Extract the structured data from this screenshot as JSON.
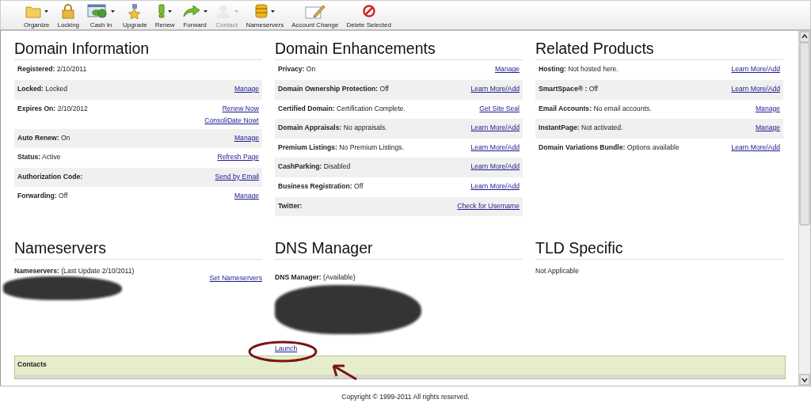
{
  "toolbar": [
    {
      "label": "Organize",
      "has_menu": true,
      "disabled": false
    },
    {
      "label": "Locking",
      "has_menu": false,
      "disabled": false
    },
    {
      "label": "Cash In",
      "has_menu": true,
      "disabled": false
    },
    {
      "label": "Upgrade",
      "has_menu": false,
      "disabled": false
    },
    {
      "label": "Renew",
      "has_menu": true,
      "disabled": false
    },
    {
      "label": "Forward",
      "has_menu": true,
      "disabled": false
    },
    {
      "label": "Contact",
      "has_menu": true,
      "disabled": true
    },
    {
      "label": "Nameservers",
      "has_menu": true,
      "disabled": false
    },
    {
      "label": "Account Change",
      "has_menu": false,
      "disabled": false
    },
    {
      "label": "Delete Selected",
      "has_menu": false,
      "disabled": false
    }
  ],
  "sections_top": [
    {
      "title": "Domain Information",
      "rows": [
        {
          "label": "Registered:",
          "value": "2/10/2011",
          "links": []
        },
        {
          "label": "Locked:",
          "value": "Locked",
          "links": [
            "Manage"
          ]
        },
        {
          "label": "Expires On:",
          "value": "2/10/2012",
          "links": [
            "Renew Now",
            "ConsoliDate Now!"
          ]
        },
        {
          "label": "Auto Renew:",
          "value": "On",
          "links": [
            "Manage"
          ]
        },
        {
          "label": "Status:",
          "value": "Active",
          "links": [
            "Refresh Page"
          ]
        },
        {
          "label": "Authorization Code:",
          "value": "",
          "links": [
            "Send by Email"
          ]
        },
        {
          "label": "Forwarding:",
          "value": "Off",
          "links": [
            "Manage"
          ]
        }
      ]
    },
    {
      "title": "Domain Enhancements",
      "rows": [
        {
          "label": "Privacy:",
          "value": "On",
          "links": [
            "Manage"
          ]
        },
        {
          "label": "Domain Ownership Protection:",
          "value": "Off",
          "links": [
            "Learn More/Add"
          ]
        },
        {
          "label": "Certified Domain:",
          "value": "Certification Complete.",
          "links": [
            "Get Site Seal"
          ]
        },
        {
          "label": "Domain Appraisals:",
          "value": "No appraisals.",
          "links": [
            "Learn More/Add"
          ]
        },
        {
          "label": "Premium Listings:",
          "value": "No Premium Listings.",
          "links": [
            "Learn More/Add"
          ]
        },
        {
          "label": "CashParking:",
          "value": "Disabled",
          "links": [
            "Learn More/Add"
          ]
        },
        {
          "label": "Business Registration:",
          "value": "Off",
          "links": [
            "Learn More/Add"
          ]
        },
        {
          "label": "Twitter:",
          "value": "",
          "links": [
            "Check for Username"
          ]
        }
      ]
    },
    {
      "title": "Related Products",
      "rows": [
        {
          "label": "Hosting:",
          "value": "Not hosted here.",
          "links": [
            "Learn More/Add"
          ]
        },
        {
          "label": "SmartSpace® :",
          "value": "Off",
          "links": [
            "Learn More/Add"
          ]
        },
        {
          "label": "Email Accounts:",
          "value": "No email accounts.",
          "links": [
            "Manage"
          ]
        },
        {
          "label": "InstantPage:",
          "value": "Not activated.",
          "links": [
            "Manage"
          ]
        },
        {
          "label": "Domain Variations Bundle:",
          "value": "Options available",
          "links": [
            "Learn More/Add"
          ]
        }
      ]
    }
  ],
  "nameservers": {
    "title": "Nameservers",
    "label": "Nameservers:",
    "value": "(Last Update 2/10/2011)",
    "link": "Set Nameservers"
  },
  "dns_manager": {
    "title": "DNS Manager",
    "label": "DNS Manager:",
    "value": "(Available)",
    "link": "Launch"
  },
  "tld_specific": {
    "title": "TLD Specific",
    "text": "Not Applicable"
  },
  "contacts": {
    "title": "Contacts"
  },
  "footer": "Copyright © 1999-2011 All rights reserved."
}
